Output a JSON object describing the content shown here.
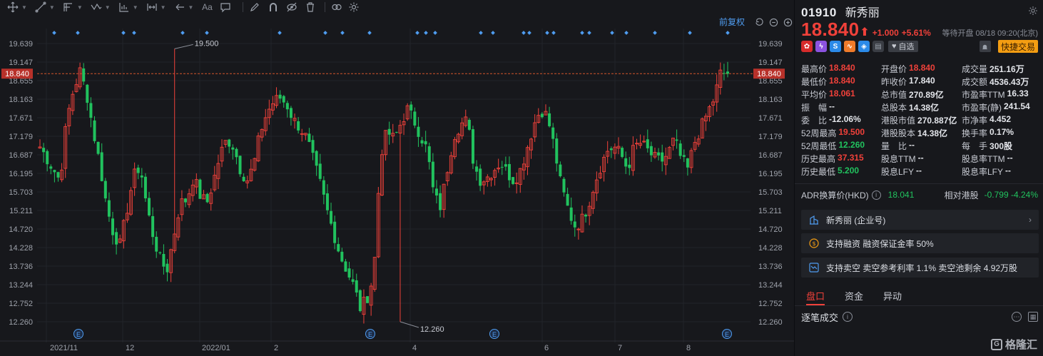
{
  "toolbar": {
    "tools": [
      "crosshair-icon",
      "trendline-icon",
      "fib-icon",
      "pattern-icon",
      "measure-icon",
      "range-icon",
      "undo-arrow-icon",
      "text-icon",
      "comment-icon",
      "pencil-icon",
      "magnet-icon",
      "eye-icon",
      "trash-icon",
      "link-icon",
      "settings-icon"
    ],
    "text_tool_label": "Aa"
  },
  "chart": {
    "restore_label": "前复权",
    "price_axis": [
      "19.639",
      "19.147",
      "18.655",
      "18.163",
      "17.671",
      "17.179",
      "16.687",
      "16.195",
      "15.703",
      "15.211",
      "14.720",
      "14.228",
      "13.736",
      "13.244",
      "12.752",
      "12.260"
    ],
    "current_price_label": "18.840",
    "high_label": "19.500",
    "low_label": "12.260",
    "time_axis": [
      "2021/11",
      "12",
      "2022/01",
      "2",
      "4",
      "6",
      "7",
      "8"
    ],
    "event_marker_label": "E",
    "colors": {
      "up": "#f0413a",
      "down": "#21c25e",
      "grid": "#22242a",
      "marker": "#4f9cf0",
      "price_line": "#d4552b"
    }
  },
  "chart_data": {
    "type": "candlestick",
    "title": "",
    "adjustment": "前复权",
    "ylim": [
      12.0,
      19.9
    ],
    "y_ticks": [
      19.639,
      19.147,
      18.655,
      18.163,
      17.671,
      17.179,
      16.687,
      16.195,
      15.703,
      15.211,
      14.72,
      14.228,
      13.736,
      13.244,
      12.752,
      12.26
    ],
    "x_ticks": [
      "2021/11",
      "12",
      "2022/01",
      "2",
      "4",
      "6",
      "7",
      "8"
    ],
    "last_price": 18.84,
    "period_high": 19.5,
    "period_low": 12.26,
    "close_path": [
      16.9,
      16.6,
      16.3,
      16.0,
      17.6,
      18.4,
      18.9,
      18.3,
      17.3,
      16.4,
      15.3,
      14.6,
      14.3,
      15.2,
      16.1,
      16.4,
      15.3,
      14.5,
      13.9,
      13.6,
      14.5,
      15.4,
      15.5,
      16.1,
      15.6,
      15.4,
      16.0,
      16.7,
      17.1,
      16.9,
      16.3,
      16.0,
      16.4,
      17.3,
      17.8,
      18.1,
      18.2,
      18.0,
      17.6,
      17.4,
      17.1,
      16.5,
      15.9,
      15.2,
      14.6,
      14.0,
      13.6,
      13.2,
      12.6,
      12.9,
      13.5,
      16.7,
      17.3,
      17.1,
      17.5,
      17.9,
      17.6,
      17.2,
      16.8,
      15.6,
      15.3,
      16.3,
      17.2,
      17.5,
      17.6,
      16.4,
      16.0,
      16.1,
      16.3,
      16.5,
      16.2,
      16.0,
      16.3,
      16.9,
      17.5,
      17.9,
      17.7,
      16.9,
      15.9,
      15.3,
      14.8,
      14.9,
      15.3,
      15.9,
      16.4,
      16.8,
      16.9,
      16.7,
      16.3,
      16.9,
      17.0,
      16.8,
      16.6,
      16.5,
      16.7,
      17.1,
      16.6,
      16.3,
      17.0,
      17.4,
      17.8,
      18.2,
      18.9,
      18.8
    ]
  },
  "quote": {
    "code": "01910",
    "name": "新秀丽",
    "price": "18.840",
    "arrow": "⬆",
    "change": "+1.000",
    "change_pct": "+5.61%",
    "status": "等待开盘 08/18 09:20(北京)",
    "badges": [
      "hk-flag-icon",
      "lightning-icon",
      "s-badge-icon",
      "connect-badge-icon",
      "tag-icon",
      "doc-icon"
    ],
    "watch_label": "自选",
    "quick_trade_label": "快捷交易",
    "stats": [
      [
        [
          "最高价",
          "18.840",
          "up"
        ],
        [
          "开盘价",
          "18.840",
          "up"
        ],
        [
          "成交量",
          "251.16万",
          ""
        ]
      ],
      [
        [
          "最低价",
          "18.840",
          "up"
        ],
        [
          "昨收价",
          "17.840",
          ""
        ],
        [
          "成交额",
          "4536.43万",
          ""
        ]
      ],
      [
        [
          "平均价",
          "18.061",
          "up"
        ],
        [
          "总市值",
          "270.89亿",
          ""
        ],
        [
          "市盈率TTM",
          "16.33",
          ""
        ]
      ],
      [
        [
          "振　幅",
          "--",
          ""
        ],
        [
          "总股本",
          "14.38亿",
          ""
        ],
        [
          "市盈率(静)",
          "241.54",
          ""
        ]
      ],
      [
        [
          "委　比",
          "-12.06%",
          ""
        ],
        [
          "港股市值",
          "270.887亿",
          ""
        ],
        [
          "市净率",
          "4.452",
          ""
        ]
      ],
      [
        [
          "52周最高",
          "19.500",
          "up"
        ],
        [
          "港股股本",
          "14.38亿",
          ""
        ],
        [
          "换手率",
          "0.17%",
          ""
        ]
      ],
      [
        [
          "52周最低",
          "12.260",
          "down"
        ],
        [
          "量　比",
          "--",
          ""
        ],
        [
          "每　手",
          "300股",
          ""
        ]
      ],
      [
        [
          "历史最高",
          "37.315",
          "up"
        ],
        [
          "股息TTM",
          "--",
          ""
        ],
        [
          "股息率TTM",
          "--",
          ""
        ]
      ],
      [
        [
          "历史最低",
          "5.200",
          "down"
        ],
        [
          "股息LFY",
          "--",
          ""
        ],
        [
          "股息率LFY",
          "--",
          ""
        ]
      ]
    ],
    "adr": {
      "label": "ADR换算价(HKD)",
      "value": "18.041",
      "rel_label": "相对港股",
      "rel_value": "-0.799 -4.24%"
    },
    "cards": [
      {
        "label": "新秀丽 (企业号)",
        "icon": "company-icon"
      },
      {
        "label": "支持融资 融资保证金率 50%",
        "icon": "margin-icon"
      },
      {
        "label": "支持卖空 卖空参考利率 1.1% 卖空池剩余 4.92万股",
        "icon": "short-icon"
      }
    ],
    "tabs": [
      "盘口",
      "资金",
      "异动"
    ],
    "ticks_label": "逐笔成交",
    "watermark": "格隆汇"
  }
}
